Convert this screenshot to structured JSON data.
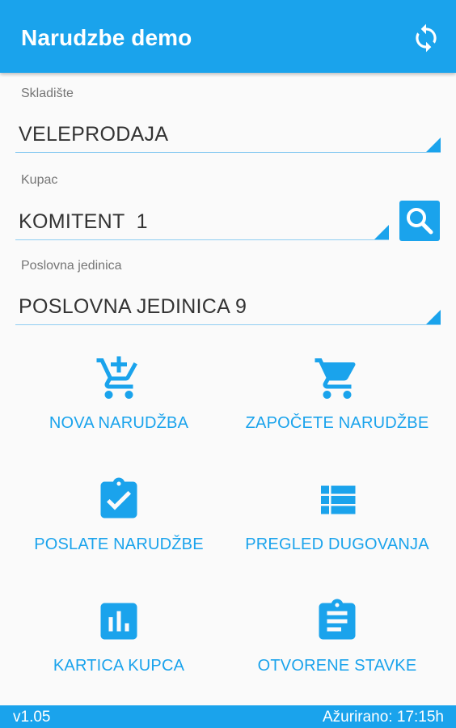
{
  "app": {
    "title": "Narudzbe demo"
  },
  "colors": {
    "primary": "#1aa3ec",
    "text": "#333333",
    "label": "#757575"
  },
  "icons": {
    "refresh": "refresh-icon",
    "search": "search-icon"
  },
  "fields": {
    "warehouse": {
      "label": "Skladište",
      "value": "VELEPRODAJA"
    },
    "customer": {
      "label": "Kupac",
      "value": "KOMITENT  1"
    },
    "unit": {
      "label": "Poslovna jedinica",
      "value": "POSLOVNA JEDINICA 9"
    }
  },
  "tiles": [
    {
      "label": "NOVA NARUDŽBA",
      "icon": "cart-add-icon"
    },
    {
      "label": "ZAPOČETE NARUDŽBE",
      "icon": "cart-icon"
    },
    {
      "label": "POSLATE NARUDŽBE",
      "icon": "clipboard-check-icon"
    },
    {
      "label": "PREGLED DUGOVANJA",
      "icon": "list-icon"
    },
    {
      "label": "KARTICA KUPCA",
      "icon": "bar-chart-icon"
    },
    {
      "label": "OTVORENE STAVKE",
      "icon": "clipboard-text-icon"
    }
  ],
  "footer": {
    "version": "v1.05",
    "updated": "Ažurirano: 17:15h"
  }
}
